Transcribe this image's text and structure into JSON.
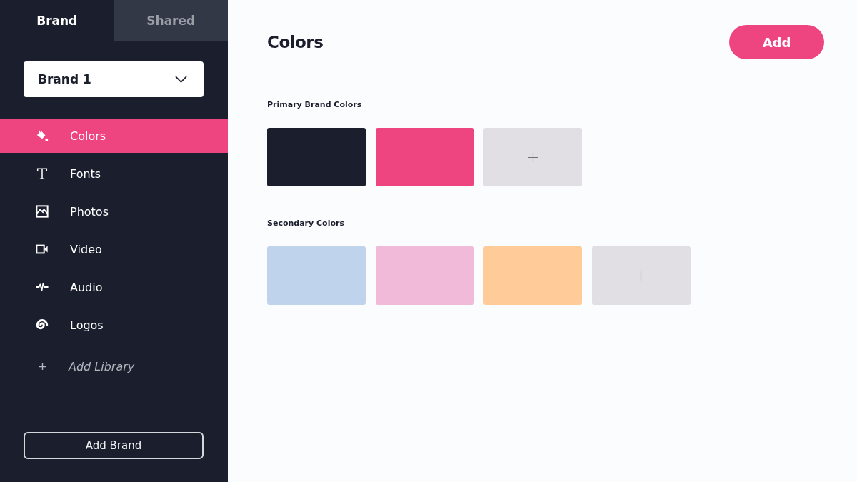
{
  "sidebar": {
    "tabs": [
      {
        "label": "Brand",
        "selected": true
      },
      {
        "label": "Shared",
        "selected": false
      }
    ],
    "brand_select": {
      "value": "Brand 1"
    },
    "nav": [
      {
        "label": "Colors",
        "selected": true
      },
      {
        "label": "Fonts",
        "selected": false
      },
      {
        "label": "Photos",
        "selected": false
      },
      {
        "label": "Video",
        "selected": false
      },
      {
        "label": "Audio",
        "selected": false
      },
      {
        "label": "Logos",
        "selected": false
      }
    ],
    "add_library": {
      "label": "Add Library"
    },
    "add_brand_button": {
      "label": "Add Brand"
    }
  },
  "main": {
    "title": "Colors",
    "add_button": {
      "label": "Add"
    },
    "sections": [
      {
        "title": "Primary Brand Colors",
        "swatches": [
          {
            "kind": "color",
            "color": "#1b1e2c"
          },
          {
            "kind": "color",
            "color": "#ee4580"
          },
          {
            "kind": "add"
          }
        ]
      },
      {
        "title": "Secondary Colors",
        "swatches": [
          {
            "kind": "color",
            "color": "#c0d3ec"
          },
          {
            "kind": "color",
            "color": "#f0bad8"
          },
          {
            "kind": "color",
            "color": "#ffcc99"
          },
          {
            "kind": "add"
          }
        ]
      }
    ]
  }
}
